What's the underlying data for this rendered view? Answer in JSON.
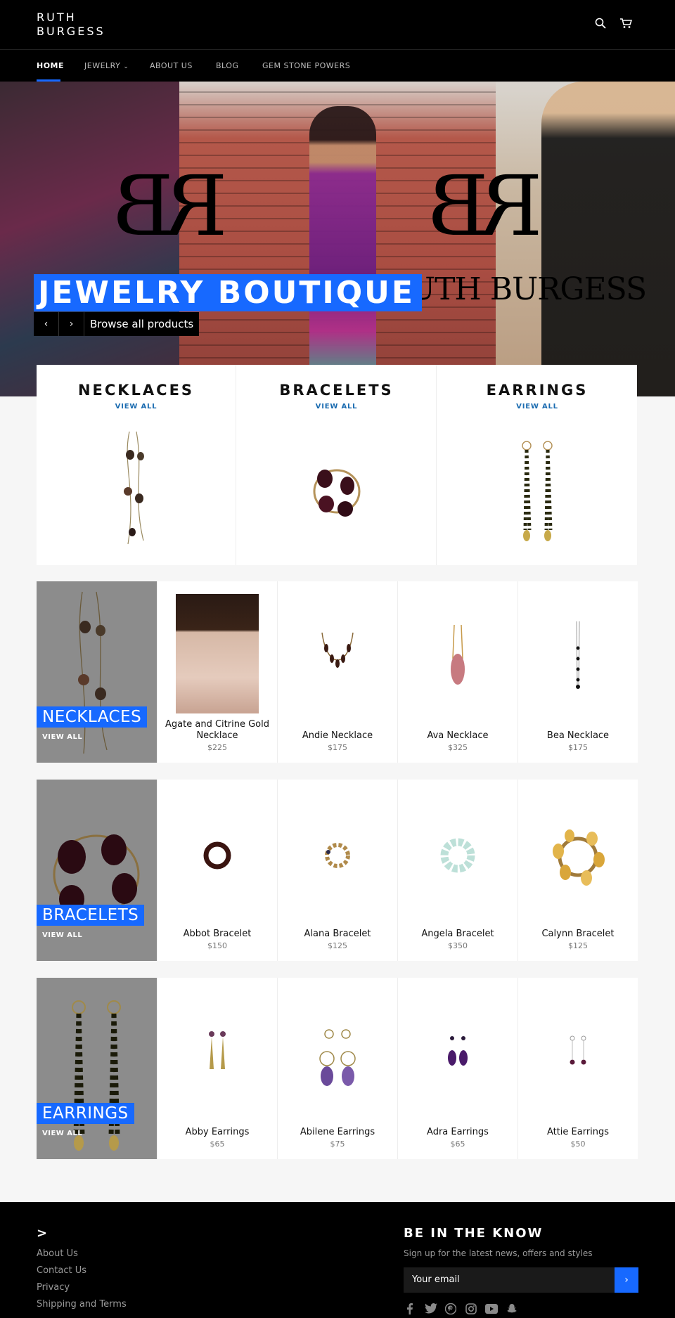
{
  "header": {
    "logo_line1": "RUTH",
    "logo_line2": "BURGESS",
    "search_icon": "search-icon",
    "cart_icon": "cart-icon"
  },
  "nav": {
    "items": [
      {
        "label": "HOME",
        "active": true
      },
      {
        "label": "JEWELRY",
        "has_dropdown": true
      },
      {
        "label": "ABOUT US"
      },
      {
        "label": "BLOG"
      },
      {
        "label": "GEM STONE POWERS"
      }
    ],
    "dropdown_glyph": "⌄",
    "accent": "#1769ff"
  },
  "hero": {
    "title": "JEWELRY BOUTIQUE",
    "brand_monogram": "RB",
    "brand_name": "UTH BURGESS",
    "prev_glyph": "‹",
    "next_glyph": "›",
    "cta": "Browse all products"
  },
  "collections": [
    {
      "title": "NECKLACES",
      "link": "VIEW ALL"
    },
    {
      "title": "BRACELETS",
      "link": "VIEW ALL"
    },
    {
      "title": "EARRINGS",
      "link": "VIEW ALL"
    }
  ],
  "product_rows": [
    {
      "label": "NECKLACES",
      "link": "VIEW ALL",
      "products": [
        {
          "name": "Agate and Citrine Gold Necklace",
          "price": "$225"
        },
        {
          "name": "Andie Necklace",
          "price": "$175"
        },
        {
          "name": "Ava Necklace",
          "price": "$325"
        },
        {
          "name": "Bea Necklace",
          "price": "$175"
        }
      ]
    },
    {
      "label": "BRACELETS",
      "link": "VIEW ALL",
      "products": [
        {
          "name": "Abbot Bracelet",
          "price": "$150"
        },
        {
          "name": "Alana Bracelet",
          "price": "$125"
        },
        {
          "name": "Angela Bracelet",
          "price": "$350"
        },
        {
          "name": "Calynn Bracelet",
          "price": "$125"
        }
      ]
    },
    {
      "label": "EARRINGS",
      "link": "VIEW ALL",
      "products": [
        {
          "name": "Abby Earrings",
          "price": "$65"
        },
        {
          "name": "Abilene Earrings",
          "price": "$75"
        },
        {
          "name": "Adra Earrings",
          "price": "$65"
        },
        {
          "name": "Attie Earrings",
          "price": "$50"
        }
      ]
    }
  ],
  "footer": {
    "heading": ">",
    "links": [
      "About Us",
      "Contact Us",
      "Privacy",
      "Shipping and Terms"
    ],
    "newsletter_title": "BE IN THE KNOW",
    "newsletter_sub": "Sign up for the latest news, offers and styles",
    "email_placeholder": "Your email",
    "submit_glyph": "›",
    "social_icons": [
      "facebook-icon",
      "twitter-icon",
      "pinterest-icon",
      "instagram-icon",
      "youtube-icon",
      "snapchat-icon"
    ]
  }
}
